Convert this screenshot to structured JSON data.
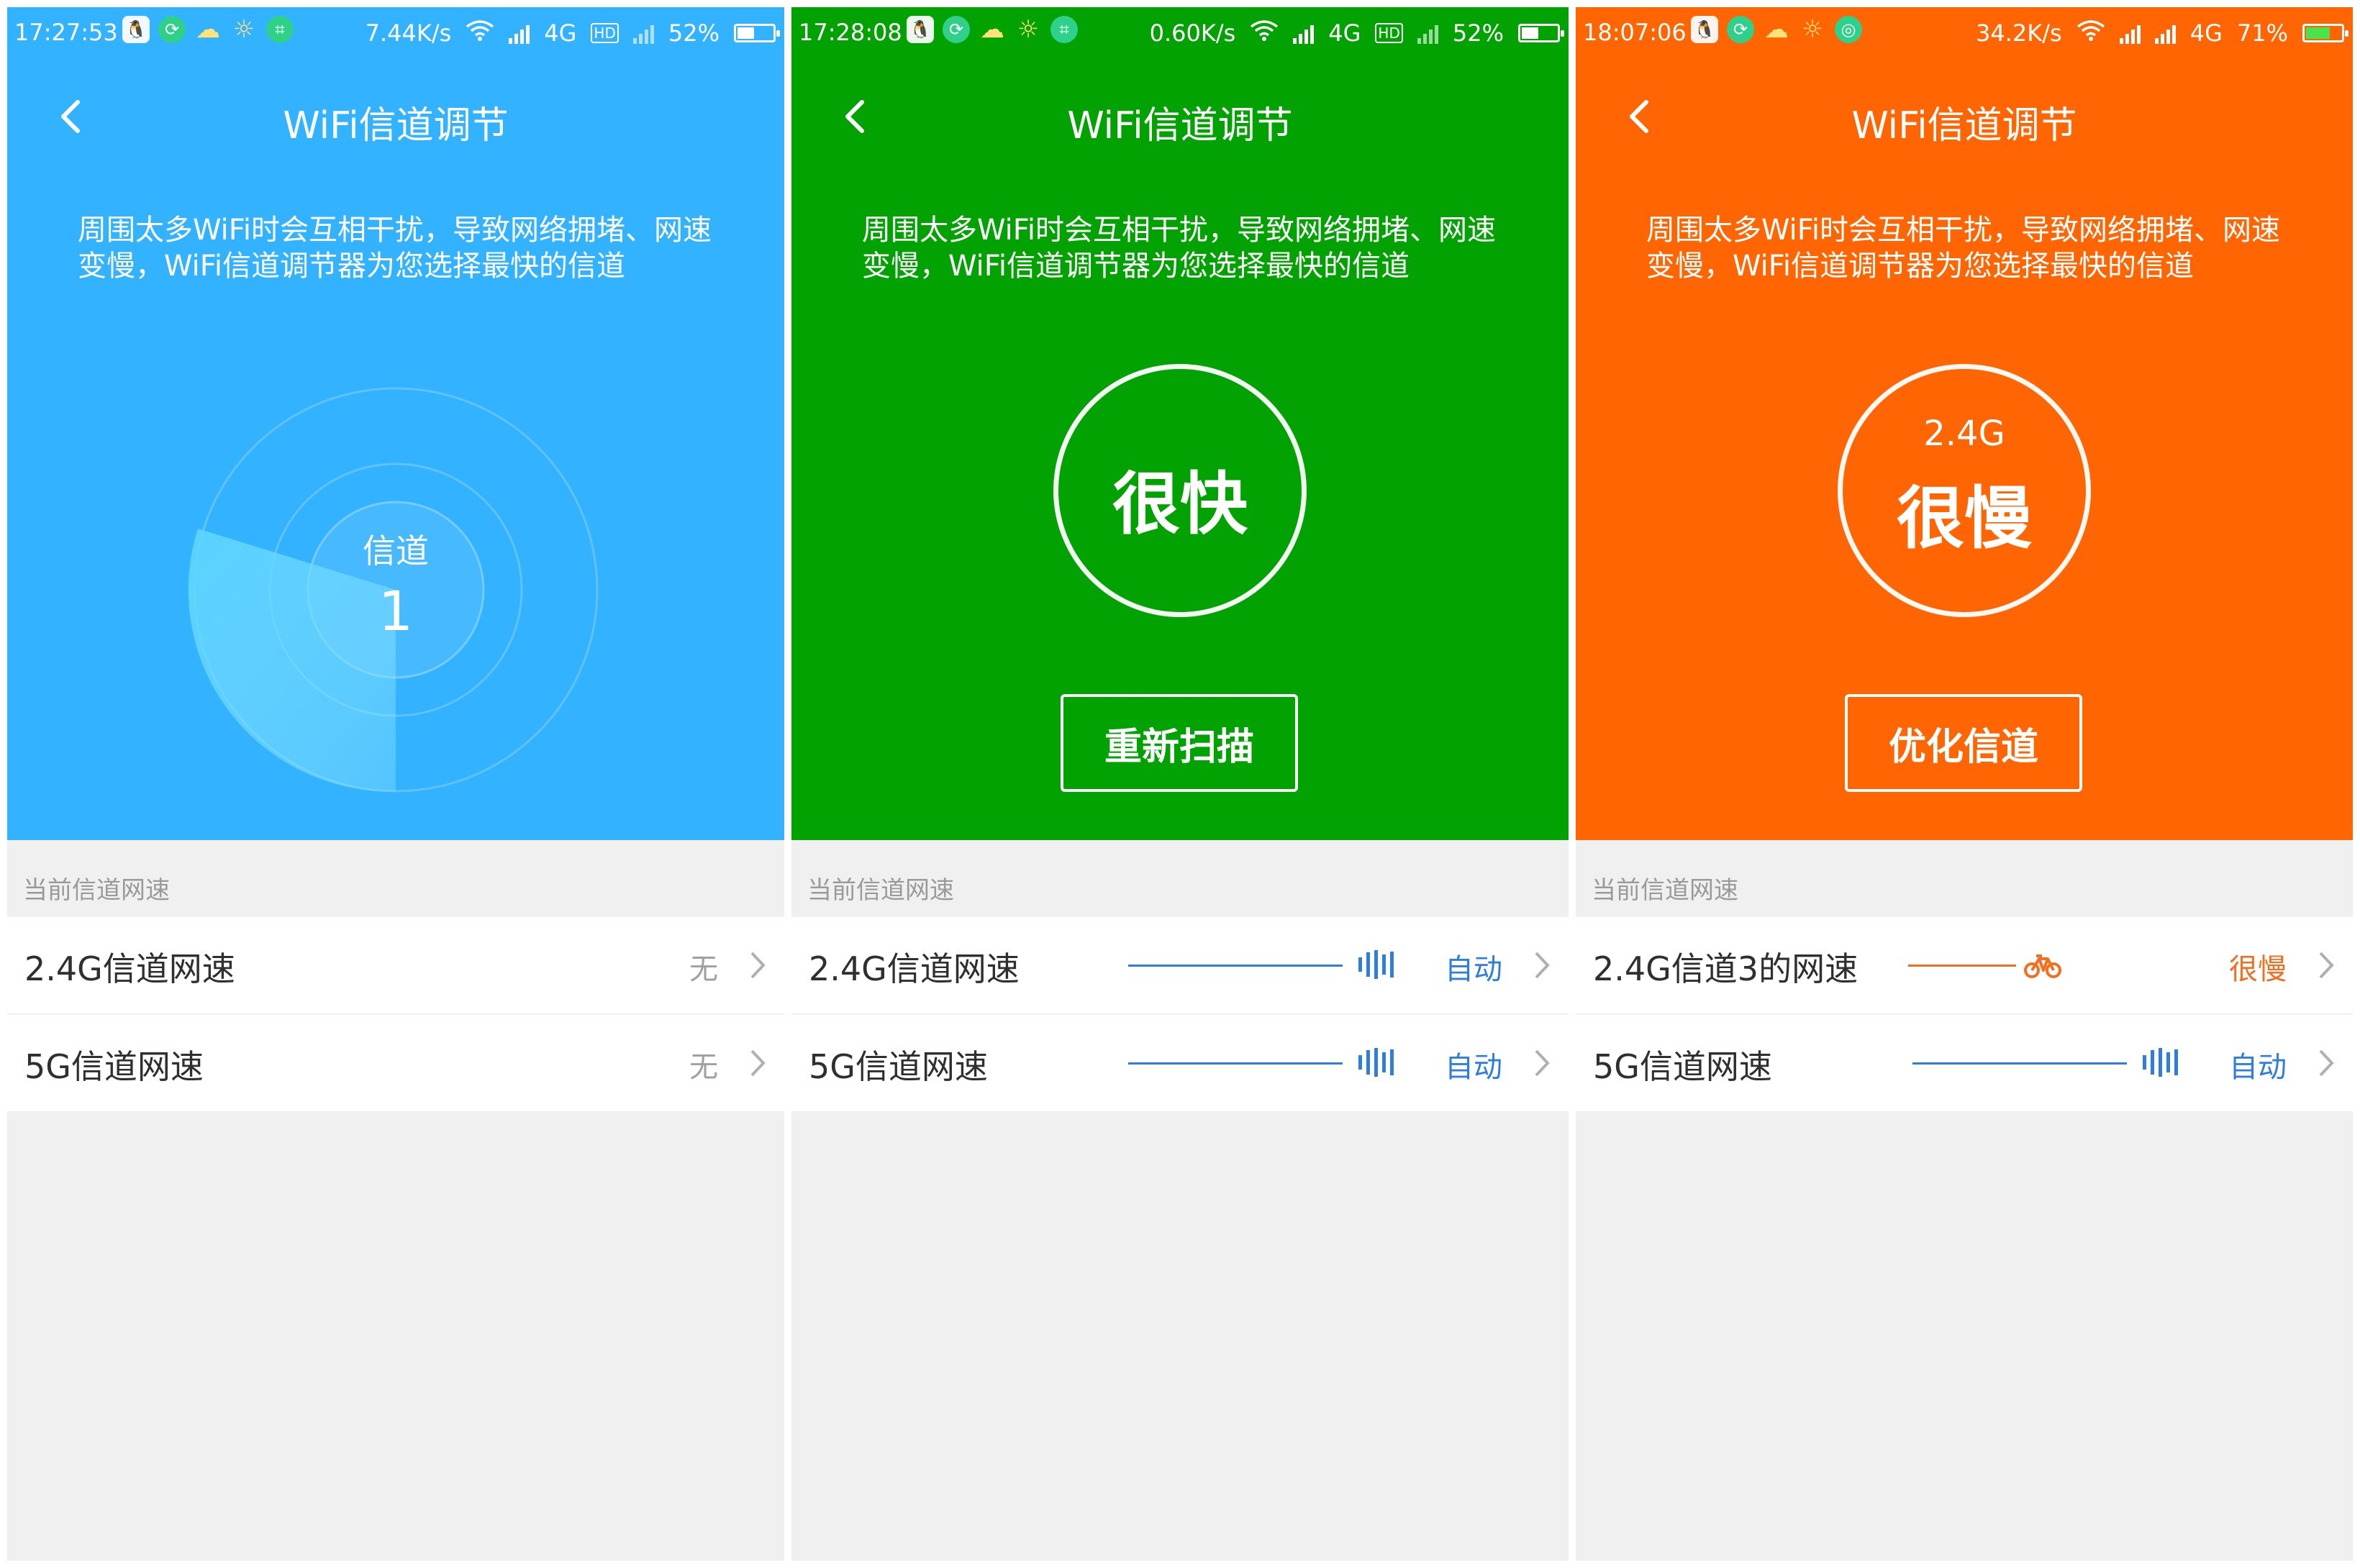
{
  "colors": {
    "panel1_bg": "#33b2ff",
    "panel2_bg": "#03a203",
    "panel3_bg": "#ff6502",
    "blue_accent": "#2e7ee0",
    "orange_accent": "#f56e1f"
  },
  "panels": [
    {
      "status": {
        "time": "17:27:53",
        "speed": "7.44K/s",
        "network": "4G",
        "network_badge": "HD",
        "battery": "52%",
        "battery_level": 0.52
      },
      "nav": {
        "title": "WiFi信道调节",
        "back_icon": "chevron-left-icon"
      },
      "description": "周围太多WiFi时会互相干扰，导致网络拥堵、网速变慢，WiFi信道调节器为您选择最快的信道",
      "radar": {
        "label": "信道",
        "channel": "1"
      },
      "section_label": "当前信道网速",
      "rows": [
        {
          "name": "2.4G信道网速",
          "value": "无"
        },
        {
          "name": "5G信道网速",
          "value": "无"
        }
      ]
    },
    {
      "status": {
        "time": "17:28:08",
        "speed": "0.60K/s",
        "network": "4G",
        "network_badge": "HD",
        "battery": "52%",
        "battery_level": 0.52
      },
      "nav": {
        "title": "WiFi信道调节",
        "back_icon": "chevron-left-icon"
      },
      "description": "周围太多WiFi时会互相干扰，导致网络拥堵、网速变慢，WiFi信道调节器为您选择最快的信道",
      "result": {
        "text": "很快"
      },
      "button": "重新扫描",
      "section_label": "当前信道网速",
      "rows": [
        {
          "name": "2.4G信道网速",
          "value": "自动",
          "indicator": "signal-bars-icon"
        },
        {
          "name": "5G信道网速",
          "value": "自动",
          "indicator": "signal-bars-icon"
        }
      ]
    },
    {
      "status": {
        "time": "18:07:06",
        "speed": "34.2K/s",
        "network": "4G",
        "battery": "71%",
        "battery_level": 0.71
      },
      "nav": {
        "title": "WiFi信道调节",
        "back_icon": "chevron-left-icon"
      },
      "description": "周围太多WiFi时会互相干扰，导致网络拥堵、网速变慢，WiFi信道调节器为您选择最快的信道",
      "result": {
        "band": "2.4G",
        "text": "很慢"
      },
      "button": "优化信道",
      "section_label": "当前信道网速",
      "rows": [
        {
          "name": "2.4G信道3的网速",
          "value": "很慢",
          "indicator": "bicycle-icon"
        },
        {
          "name": "5G信道网速",
          "value": "自动",
          "indicator": "signal-bars-icon"
        }
      ]
    }
  ]
}
